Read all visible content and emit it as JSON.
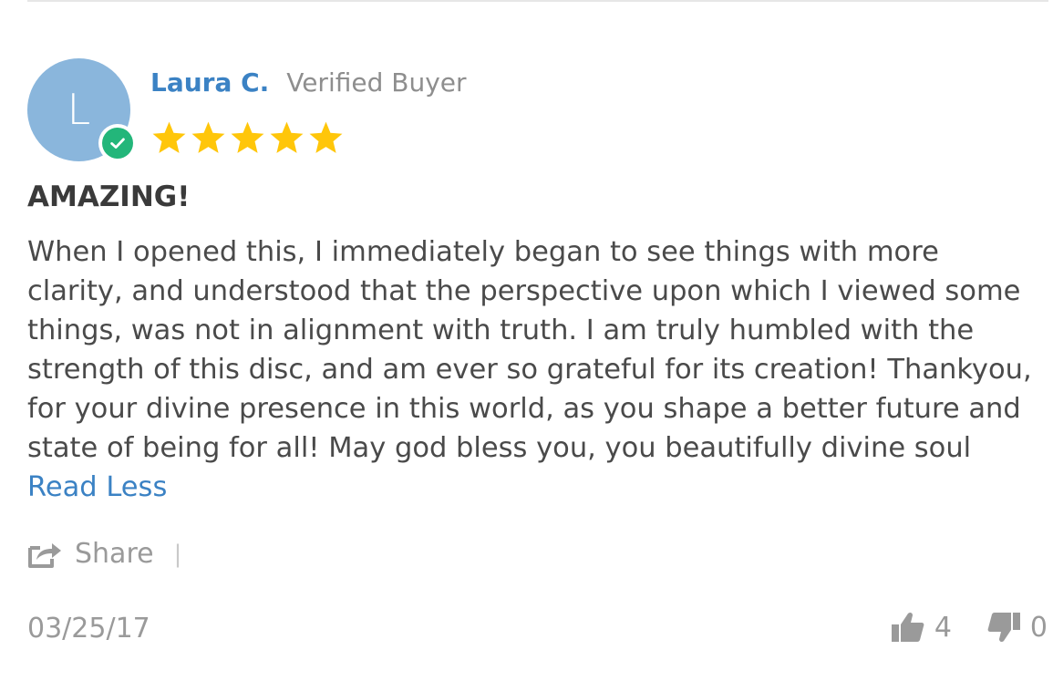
{
  "review": {
    "avatar_initial": "L",
    "author_name": "Laura C.",
    "verified_label": "Verified Buyer",
    "rating": 5,
    "rating_max": 5,
    "title": "AMAZING!",
    "body": "When I opened this, I immediately began to see things with more clarity, and understood that the perspective upon which I viewed some things, was not in alignment with truth. I am truly humbled with the strength of this disc, and am ever so grateful for its creation! Thankyou, for your divine presence in this world, as you shape a better future and state of being for all! May god bless you, you beautifully divine soul",
    "read_less_label": "Read Less",
    "share_label": "Share",
    "share_separator": "|",
    "date": "03/25/17",
    "thumbs_up_count": "4",
    "thumbs_down_count": "0"
  },
  "colors": {
    "link": "#3b82c4",
    "star": "#ffc60a",
    "avatar": "#8ab6dc",
    "verified_badge": "#23b67a",
    "muted": "#9a9a9a"
  },
  "icons": {
    "verified": "check-circle-icon",
    "star": "star-icon",
    "share": "share-icon",
    "thumbs_up": "thumbs-up-icon",
    "thumbs_down": "thumbs-down-icon"
  }
}
